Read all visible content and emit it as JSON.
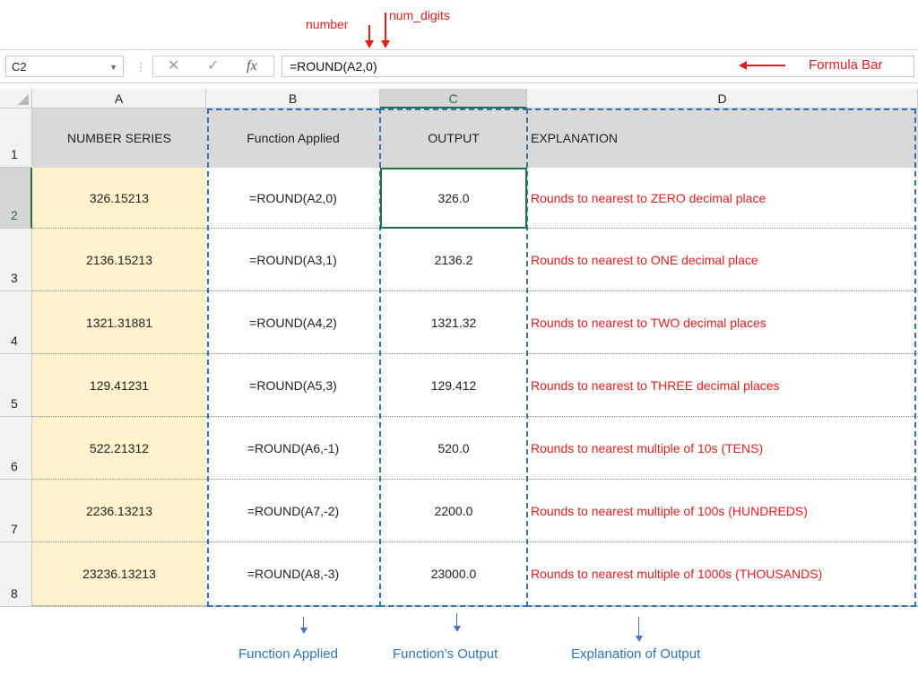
{
  "annotations": {
    "number_label": "number",
    "num_digits_label": "num_digits",
    "formula_bar_label": "Formula Bar",
    "bottom": {
      "function_applied": "Function Applied",
      "functions_output": "Function’s Output",
      "explanation_of_output": "Explanation of Output"
    }
  },
  "formula_bar": {
    "name_box": "C2",
    "formula": "=ROUND(A2,0)"
  },
  "columns": [
    "A",
    "B",
    "C",
    "D"
  ],
  "header_row": {
    "row_number": "1",
    "a": "NUMBER SERIES",
    "b": "Function Applied",
    "c": "OUTPUT",
    "d": "EXPLANATION"
  },
  "rows": [
    {
      "row_number": "2",
      "a": "326.15213",
      "b": "=ROUND(A2,0)",
      "c": "326.0",
      "d": "Rounds to nearest to ZERO decimal place"
    },
    {
      "row_number": "3",
      "a": "2136.15213",
      "b": "=ROUND(A3,1)",
      "c": "2136.2",
      "d": "Rounds to nearest to ONE decimal place"
    },
    {
      "row_number": "4",
      "a": "1321.31881",
      "b": "=ROUND(A4,2)",
      "c": "1321.32",
      "d": "Rounds to nearest to TWO decimal places"
    },
    {
      "row_number": "5",
      "a": "129.41231",
      "b": "=ROUND(A5,3)",
      "c": "129.412",
      "d": "Rounds to nearest to THREE decimal places"
    },
    {
      "row_number": "6",
      "a": "522.21312",
      "b": "=ROUND(A6,-1)",
      "c": "520.0",
      "d": "Rounds to nearest multiple of 10s (TENS)"
    },
    {
      "row_number": "7",
      "a": "2236.13213",
      "b": "=ROUND(A7,-2)",
      "c": "2200.0",
      "d": "Rounds to nearest multiple of 100s (HUNDREDS)"
    },
    {
      "row_number": "8",
      "a": "23236.13213",
      "b": "=ROUND(A8,-3)",
      "c": "23000.0",
      "d": "Rounds to nearest multiple of 1000s (THOUSANDS)"
    }
  ],
  "colors": {
    "annotation_red": "#e02020",
    "annotation_blue": "#2e75b6",
    "number_series_fill": "#fff2cc",
    "header_fill": "#d9d9d9",
    "selection_green": "#217346"
  }
}
